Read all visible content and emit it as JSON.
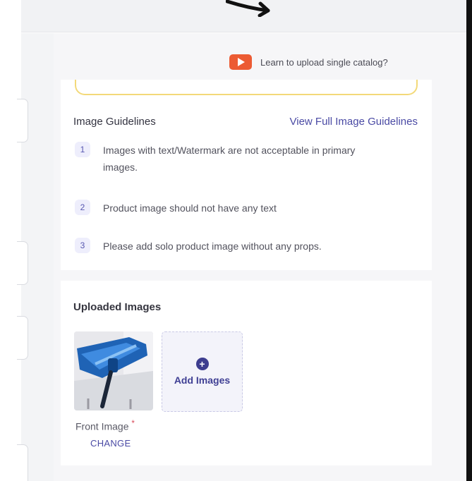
{
  "header": {
    "help_link": "Learn to upload single catalog?",
    "help_icon": "youtube-play-icon"
  },
  "guidelines": {
    "title": "Image Guidelines",
    "view_link": "View Full Image Guidelines",
    "items": [
      {
        "num": "1",
        "text": "Images with text/Watermark are not acceptable in primary images."
      },
      {
        "num": "2",
        "text": "Product image should not have any text"
      },
      {
        "num": "3",
        "text": "Please add solo product image without any props."
      }
    ]
  },
  "uploaded": {
    "title": "Uploaded Images",
    "add_label": "Add Images",
    "add_icon": "plus-circle-icon",
    "image_caption": "Front Image",
    "required_mark": "*",
    "change_label": "CHANGE"
  },
  "colors": {
    "accent": "#4a4aa4",
    "youtube": "#ec5b33",
    "highlight_border": "#f3d979"
  }
}
